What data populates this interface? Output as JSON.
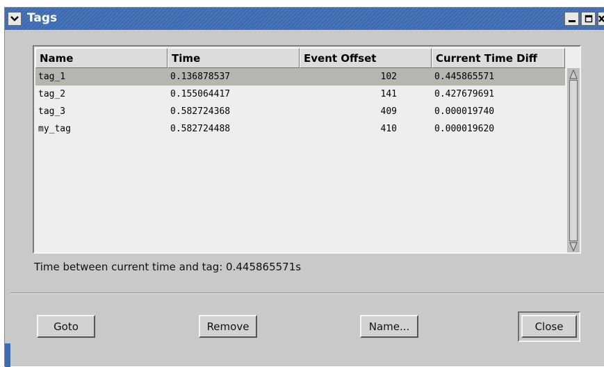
{
  "window": {
    "title": "Tags"
  },
  "table": {
    "columns": [
      "Name",
      "Time",
      "Event Offset",
      "Current Time Diff"
    ],
    "rows": [
      {
        "name": "tag_1",
        "time": "0.136878537",
        "offset": "102",
        "diff": "0.445865571",
        "selected": true
      },
      {
        "name": "tag_2",
        "time": "0.155064417",
        "offset": "141",
        "diff": "0.427679691",
        "selected": false
      },
      {
        "name": "tag_3",
        "time": "0.582724368",
        "offset": "409",
        "diff": "0.000019740",
        "selected": false
      },
      {
        "name": "my_tag",
        "time": "0.582724488",
        "offset": "410",
        "diff": "0.000019620",
        "selected": false
      }
    ]
  },
  "status": {
    "text": "Time between current time and tag: 0.445865571s"
  },
  "buttons": {
    "goto": "Goto",
    "remove": "Remove",
    "name": "Name...",
    "close": "Close"
  },
  "colors": {
    "titlebar": "#3e6bb1",
    "window_bg": "#c9c9c9",
    "selected_row": "#b7b5b0"
  }
}
